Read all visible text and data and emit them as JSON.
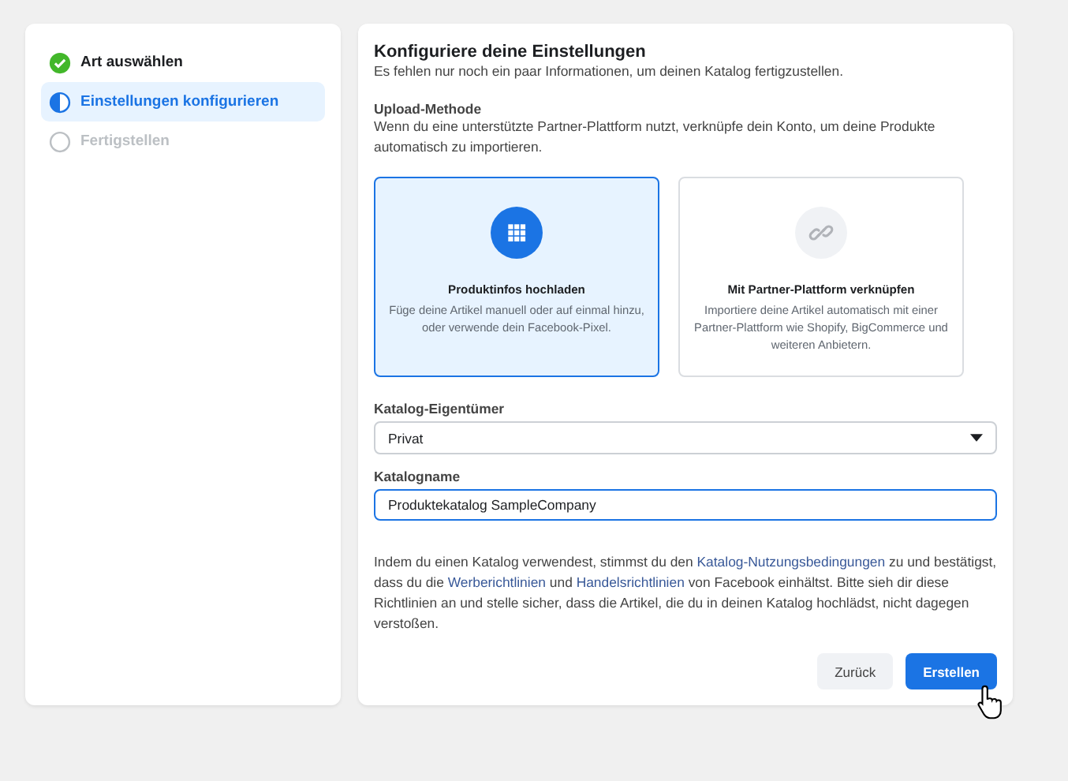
{
  "steps": [
    {
      "label": "Art auswählen",
      "kind": "done",
      "selected": false
    },
    {
      "label": "Einstellungen konfigurieren",
      "kind": "current",
      "selected": true
    },
    {
      "label": "Fertigstellen",
      "kind": "pending",
      "selected": false
    }
  ],
  "panel": {
    "title": "Konfiguriere deine Einstellungen",
    "subtitle": "Es fehlen nur noch ein paar Informationen, um deinen Katalog fertigzustellen.",
    "upload": {
      "label": "Upload-Methode",
      "description": "Wenn du eine unterstützte Partner-Plattform nutzt, verknüpfe dein Konto, um deine Produkte automatisch zu importieren.",
      "options": [
        {
          "kind": "grid",
          "title": "Produktinfos hochladen",
          "description": "Füge deine Artikel manuell oder auf einmal hinzu, oder verwende dein Facebook-Pixel.",
          "selected": true
        },
        {
          "kind": "link",
          "title": "Mit Partner-Plattform verknüpfen",
          "description": "Importiere deine Artikel automatisch mit einer Partner-Plattform wie Shopify, BigCommerce und weiteren Anbietern.",
          "selected": false
        }
      ]
    },
    "owner": {
      "label": "Katalog-Eigentümer",
      "value": "Privat"
    },
    "name": {
      "label": "Katalogname",
      "value": "Produktekatalog SampleCompany",
      "focused": true
    },
    "terms": [
      {
        "kind": "text",
        "text": "Indem du einen Katalog verwendest, stimmst du den "
      },
      {
        "kind": "link",
        "text": "Katalog-Nutzungsbedingungen"
      },
      {
        "kind": "text",
        "text": " zu und bestätigst, dass du die "
      },
      {
        "kind": "link",
        "text": "Werberichtlinien"
      },
      {
        "kind": "text",
        "text": " und "
      },
      {
        "kind": "link",
        "text": "Handelsrichtlinien"
      },
      {
        "kind": "text",
        "text": " von Facebook einhältst. Bitte sieh dir diese Richtlinien an und stelle sicher, dass die Artikel, die du in deinen Katalog hochlädst, nicht dagegen verstoßen."
      }
    ],
    "buttons": [
      {
        "label": "Zurück",
        "kind": "secondary"
      },
      {
        "label": "Erstellen",
        "kind": "primary"
      }
    ]
  }
}
